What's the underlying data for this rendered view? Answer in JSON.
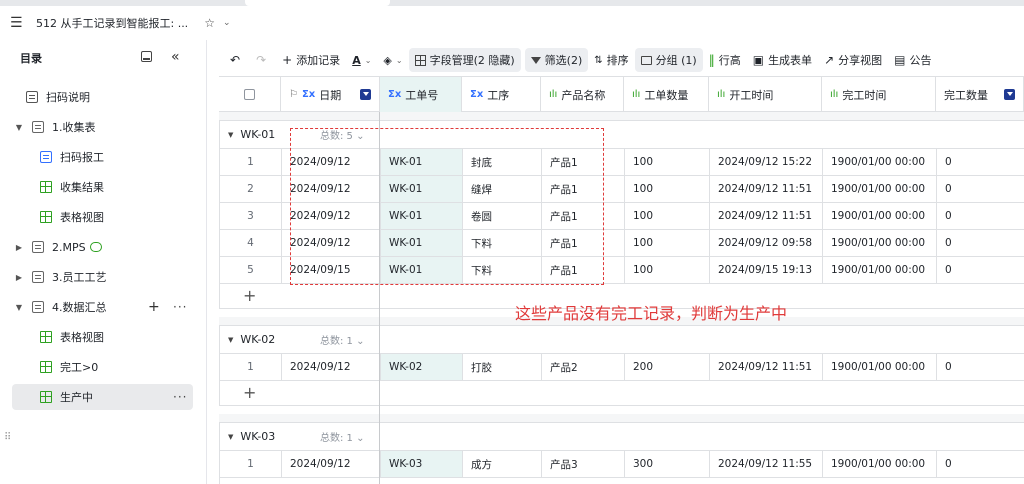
{
  "header": {
    "doc_title": "512 从手工记录到智能报工: ...",
    "star_icon": "☆",
    "chevron_icon": "⌄",
    "menu_icon": "☰"
  },
  "sidebar": {
    "title": "目录",
    "fold_icon": "«",
    "items": [
      {
        "label": "扫码说明",
        "icon": "doc-icon"
      },
      {
        "label": "1.收集表",
        "icon": "folder-icon",
        "expanded": true
      },
      {
        "label": "扫码报工",
        "icon": "form-icon"
      },
      {
        "label": "收集结果",
        "icon": "grid-icon"
      },
      {
        "label": "表格视图",
        "icon": "grid-icon"
      },
      {
        "label": "2.MPS",
        "icon": "folder-icon",
        "expanded": false
      },
      {
        "label": "3.员工工艺",
        "icon": "folder-icon",
        "expanded": false
      },
      {
        "label": "4.数据汇总",
        "icon": "folder-icon",
        "expanded": true
      },
      {
        "label": "表格视图",
        "icon": "grid-icon"
      },
      {
        "label": "完工>0",
        "icon": "grid-icon"
      },
      {
        "label": "生产中",
        "icon": "grid-icon",
        "active": true
      }
    ],
    "plus": "+",
    "more": "···"
  },
  "toolbar": {
    "undo": "↶",
    "redo": "↷",
    "add_record": "添加记录",
    "text_format": "A",
    "fill": "◈",
    "field_manage": "字段管理(2 隐藏)",
    "filter": "筛选(2)",
    "sort": "排序",
    "group": "分组 (1)",
    "row_height": "行高",
    "gen_form": "生成表单",
    "share_view": "分享视图",
    "announcement": "公告"
  },
  "columns": [
    {
      "label": "",
      "type": "checkbox"
    },
    {
      "label": "日期",
      "icon": "Σx",
      "extra": "⚐",
      "sort_badge": true
    },
    {
      "label": "工单号",
      "icon": "Σx"
    },
    {
      "label": "工序",
      "icon": "Σx"
    },
    {
      "label": "产品名称",
      "icon": "ılı"
    },
    {
      "label": "工单数量",
      "icon": "ılı"
    },
    {
      "label": "开工时间",
      "icon": "ılı"
    },
    {
      "label": "完工时间",
      "icon": "ılı"
    },
    {
      "label": "完工数量",
      "icon": "",
      "sort_badge": true
    }
  ],
  "groups": [
    {
      "name": "WK-01",
      "count_label": "总数: 5 ⌄",
      "rows": [
        [
          "1",
          "2024/09/12",
          "WK-01",
          "封底",
          "产品1",
          "100",
          "2024/09/12 15:22",
          "1900/01/00 00:00",
          "0"
        ],
        [
          "2",
          "2024/09/12",
          "WK-01",
          "缝焊",
          "产品1",
          "100",
          "2024/09/12 11:51",
          "1900/01/00 00:00",
          "0"
        ],
        [
          "3",
          "2024/09/12",
          "WK-01",
          "卷圆",
          "产品1",
          "100",
          "2024/09/12 11:51",
          "1900/01/00 00:00",
          "0"
        ],
        [
          "4",
          "2024/09/12",
          "WK-01",
          "下料",
          "产品1",
          "100",
          "2024/09/12 09:58",
          "1900/01/00 00:00",
          "0"
        ],
        [
          "5",
          "2024/09/15",
          "WK-01",
          "下料",
          "产品1",
          "100",
          "2024/09/15 19:13",
          "1900/01/00 00:00",
          "0"
        ]
      ]
    },
    {
      "name": "WK-02",
      "count_label": "总数: 1 ⌄",
      "rows": [
        [
          "1",
          "2024/09/12",
          "WK-02",
          "打胶",
          "产品2",
          "200",
          "2024/09/12 11:51",
          "1900/01/00 00:00",
          "0"
        ]
      ]
    },
    {
      "name": "WK-03",
      "count_label": "总数: 1 ⌄",
      "rows": [
        [
          "1",
          "2024/09/12",
          "WK-03",
          "成方",
          "产品3",
          "300",
          "2024/09/12 11:55",
          "1900/01/00 00:00",
          "0"
        ]
      ]
    }
  ],
  "add_row_icon": "+",
  "annotation": "这些产品没有完工记录，判断为生产中",
  "colors": {
    "accent": "#3370ff",
    "highlight_column": "#e8f4f3",
    "annotation": "#e03a3a",
    "grid_icon": "#2ea121"
  }
}
